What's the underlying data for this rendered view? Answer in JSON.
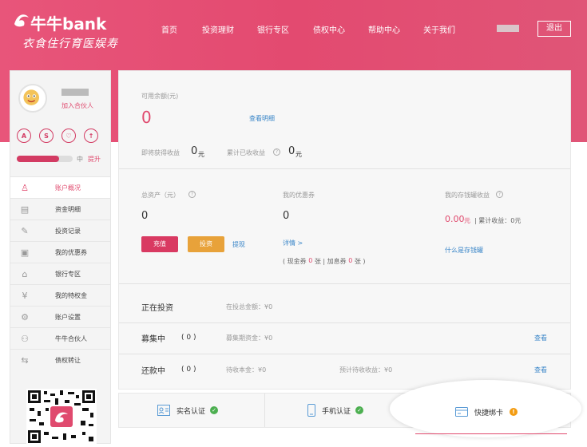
{
  "header": {
    "brand": "牛牛bank",
    "slogan": "衣食住行育医娱寿",
    "nav": [
      "首页",
      "投资理财",
      "银行专区",
      "债权中心",
      "帮助中心",
      "关于我们"
    ],
    "logout": "退出"
  },
  "profile": {
    "partner_link": "加入合伙人",
    "level_label": "中",
    "upgrade_link": "提升",
    "progress": 0.75,
    "badges": [
      "A",
      "S",
      "♡",
      "↑"
    ]
  },
  "sidebar": {
    "items": [
      {
        "label": "账户概况",
        "icon": "person-icon",
        "active": true
      },
      {
        "label": "资金明细",
        "icon": "document-icon"
      },
      {
        "label": "投资记录",
        "icon": "record-icon"
      },
      {
        "label": "我的优惠券",
        "icon": "coupon-icon"
      },
      {
        "label": "银行专区",
        "icon": "bank-icon"
      },
      {
        "label": "我的特权金",
        "icon": "privilege-icon"
      },
      {
        "label": "账户设置",
        "icon": "gear-icon"
      },
      {
        "label": "牛牛合伙人",
        "icon": "partners-icon"
      },
      {
        "label": "债权转让",
        "icon": "transfer-icon"
      }
    ]
  },
  "balance": {
    "label": "可用余额(元)",
    "value": "0",
    "detail_link": "查看明细",
    "pending_label": "即将获得收益",
    "pending_value": "0",
    "pending_unit": "元",
    "received_label": "累计已收收益",
    "received_value": "0",
    "received_unit": "元"
  },
  "assets": {
    "total_label": "总资产（元）",
    "total_value": "0",
    "recharge": "充值",
    "invest": "投资",
    "withdraw": "提现",
    "coupon_label": "我的优惠券",
    "coupon_value": "0",
    "coupon_detail": "详情 >",
    "coupon_note_prefix": "( 现金券",
    "coupon_cash": "0",
    "coupon_note_mid": "张 | 加息券",
    "coupon_rate": "0",
    "coupon_note_suffix": "张 )",
    "savings_label": "我的存钱罐收益",
    "savings_value": "0.00",
    "savings_unit": "元",
    "savings_total": "| 累计收益：0元",
    "savings_link": "什么是存钱罐"
  },
  "investments": [
    {
      "title": "正在投资",
      "count": "",
      "field1": "在投总金额：¥0",
      "field2": "",
      "view": ""
    },
    {
      "title": "募集中",
      "count": "( 0 )",
      "field1": "募集期资金：¥0",
      "field2": "",
      "view": "查看"
    },
    {
      "title": "还款中",
      "count": "( 0 )",
      "field1": "待收本金：¥0",
      "field2": "预计待收收益：¥0",
      "view": "查看"
    }
  ],
  "verify": {
    "realname": "实名认证",
    "phone": "手机认证",
    "bindcard": "快捷绑卡"
  }
}
